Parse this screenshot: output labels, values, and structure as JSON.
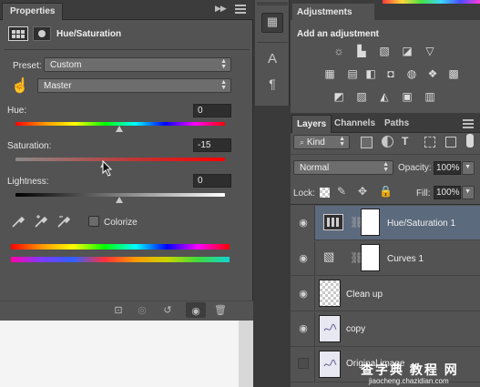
{
  "properties": {
    "tab_label": "Properties",
    "title": "Hue/Saturation",
    "preset_label": "Preset:",
    "preset_value": "Custom",
    "channel_value": "Master",
    "hue_label": "Hue:",
    "hue_value": "0",
    "saturation_label": "Saturation:",
    "saturation_value": "-15",
    "lightness_label": "Lightness:",
    "lightness_value": "0",
    "colorize_label": "Colorize",
    "colorize_checked": false
  },
  "adjustments": {
    "tab_label": "Adjustments",
    "add_label": "Add an adjustment",
    "icons_row1": [
      "brightness-icon",
      "levels-icon",
      "curves-icon",
      "exposure-icon",
      "gradient-triangle-icon"
    ],
    "icons_row2": [
      "vibrance-icon",
      "hue-sat-icon",
      "color-balance-icon",
      "bw-icon",
      "photo-filter-icon",
      "channel-mixer-icon",
      "color-lookup-icon"
    ],
    "icons_row3": [
      "invert-icon",
      "posterize-icon",
      "threshold-icon",
      "selective-color-icon",
      "gradient-map-icon"
    ]
  },
  "layers": {
    "tabs": [
      "Layers",
      "Channels",
      "Paths"
    ],
    "kind_label": "Kind",
    "blend_mode": "Normal",
    "opacity_label": "Opacity:",
    "opacity_value": "100%",
    "lock_label": "Lock:",
    "fill_label": "Fill:",
    "fill_value": "100%",
    "items": [
      {
        "name": "Hue/Saturation 1",
        "visible": true
      },
      {
        "name": "Curves 1",
        "visible": true
      },
      {
        "name": "Clean up",
        "visible": true
      },
      {
        "name": "copy",
        "visible": true
      },
      {
        "name": "Original image",
        "visible": false
      }
    ]
  },
  "watermark": {
    "text": "查字典 教程 网",
    "url": "jiaocheng.chazidian.com"
  },
  "colors": {
    "panel_bg": "#535353",
    "tab_bar_bg": "#3c3c3c",
    "selected_layer": "#5c6a7d"
  }
}
